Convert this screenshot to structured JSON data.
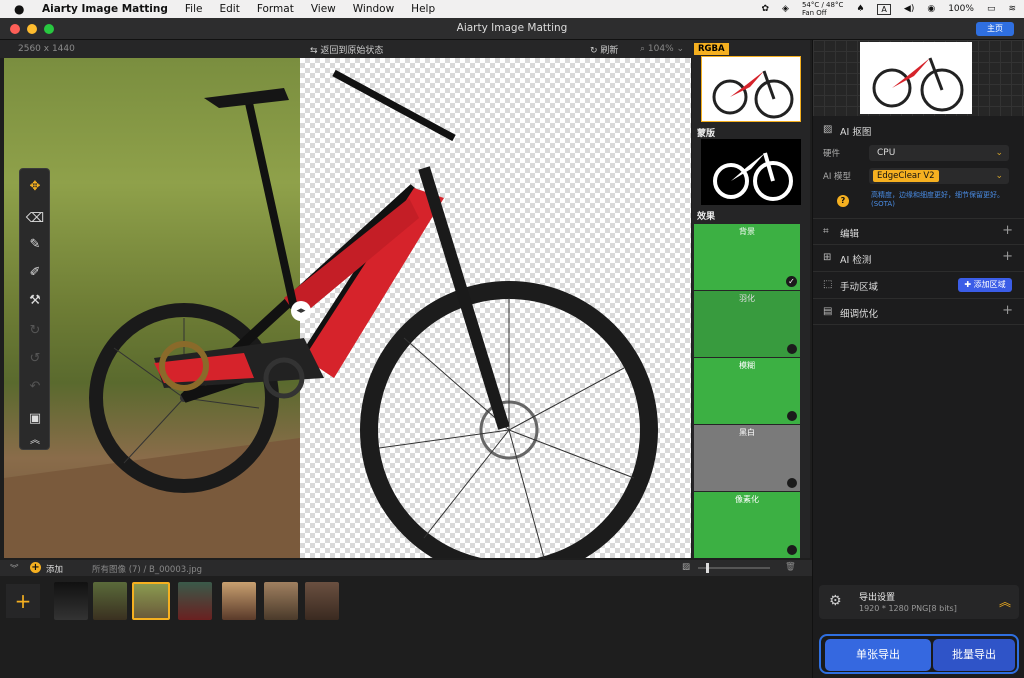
{
  "menubar": {
    "apple": "",
    "app": "Aiarty Image Matting",
    "items": [
      "File",
      "Edit",
      "Format",
      "View",
      "Window",
      "Help"
    ],
    "temp_line1": "54°C / 48°C",
    "temp_line2": "Fan Off",
    "input_indicator": "A",
    "battery": "100%"
  },
  "window": {
    "title": "Aiarty Image Matting",
    "home_button": "主页"
  },
  "canvas_toolbar": {
    "dimensions": "2560 x 1440",
    "revert": "返回到原始状态",
    "refresh": "刷新",
    "zoom": "104%"
  },
  "strip": {
    "rgba": "RGBA",
    "mask": "蒙版",
    "effects": "效果",
    "effect_items": [
      {
        "name": "背景",
        "selected": true,
        "style": "green"
      },
      {
        "name": "羽化",
        "selected": false,
        "style": "green"
      },
      {
        "name": "模糊",
        "selected": false,
        "style": "green"
      },
      {
        "name": "黑白",
        "selected": false,
        "style": "gray"
      },
      {
        "name": "像素化",
        "selected": false,
        "style": "green"
      }
    ]
  },
  "panel": {
    "ai_matting": "AI 抠图",
    "hardware_label": "硬件",
    "hardware_value": "CPU",
    "model_label": "AI 模型",
    "model_value": "EdgeClear V2",
    "model_desc": "高精度，边缘和细度更好，细节保留更好。(SOTA)",
    "edit": "编辑",
    "ai_detect": "AI 检测",
    "manual_region": "手动区域",
    "add_region": "添加区域",
    "refine": "细调优化",
    "export_settings": "导出设置",
    "export_spec": "1920 * 1280 PNG[8 bits]",
    "single_export": "单张导出",
    "batch_export": "批量导出"
  },
  "bottom": {
    "add": "添加",
    "crumb": "所有图像 (7)   /  B_00003.jpg",
    "thumbnail_count": 7,
    "selected_index": 2
  },
  "colors": {
    "accent": "#f5b020",
    "blue": "#2f6fe0",
    "green_effect": "#3cb043",
    "bike_red": "#e0202a"
  }
}
